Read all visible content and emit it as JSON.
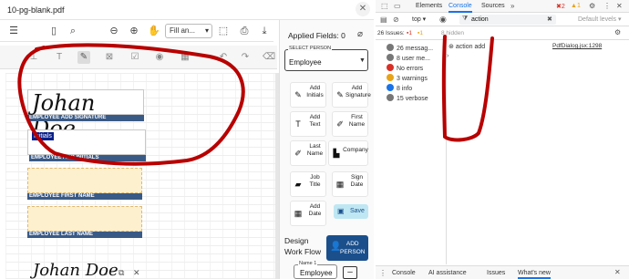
{
  "window": {
    "title": "10-pg-blank.pdf",
    "close": "✕"
  },
  "viewer": {
    "zoom_value": "Fill an..."
  },
  "document": {
    "sig1_text": "Johan Doe",
    "sig1_label": "EMPLOYEE ADD SIGNATURE",
    "initials_tag": "Initials",
    "initials_label": "EMPLOYEE ADD INITIALS",
    "first_name_label": "EMPLOYEE FIRST NAME",
    "last_name_label": "EMPLOYEE LAST NAME",
    "sig2_text": "Johan Doe"
  },
  "panel": {
    "applied_fields": "Applied Fields: 0",
    "select_person_label": "SELECT PERSON",
    "select_person_value": "Employee",
    "tiles": [
      {
        "label": "Add\nInitials"
      },
      {
        "label": "Add\nSignature"
      },
      {
        "label": "Add\nText"
      },
      {
        "label": "First\nName"
      },
      {
        "label": "Last\nName"
      },
      {
        "label": "Company"
      },
      {
        "label": "Job\nTitle"
      },
      {
        "label": "Sign\nDate"
      },
      {
        "label": "Add\nDate"
      }
    ],
    "save": "Save",
    "design_workflow": "Design\nWork Flow",
    "add_person": "ADD\nPERSON",
    "name_legend": "Name 1",
    "name_value": "Employee",
    "minus": "–"
  },
  "devtools": {
    "tabs": [
      "Elements",
      "Console",
      "Sources"
    ],
    "badges": {
      "errors": "2",
      "warnings": "1"
    },
    "context": "top",
    "filter": "action",
    "levels": "Default levels",
    "issues": "26 Issues:",
    "issues_errors": "1",
    "issues_warnings": "1",
    "hidden": "8 hidden",
    "sidebar": [
      {
        "label": "26 messag...",
        "color": "#777"
      },
      {
        "label": "8 user me...",
        "color": "#777"
      },
      {
        "label": "No errors",
        "color": "#d93025"
      },
      {
        "label": "3 warnings",
        "color": "#e8a317"
      },
      {
        "label": "8 info",
        "color": "#1a73e8"
      },
      {
        "label": "15 verbose",
        "color": "#777"
      }
    ],
    "log_text": "action add",
    "log_source": "PdfDialog.jsx:1298",
    "bottom_tabs": [
      "Console",
      "AI assistance",
      "Issues",
      "What's new"
    ]
  }
}
